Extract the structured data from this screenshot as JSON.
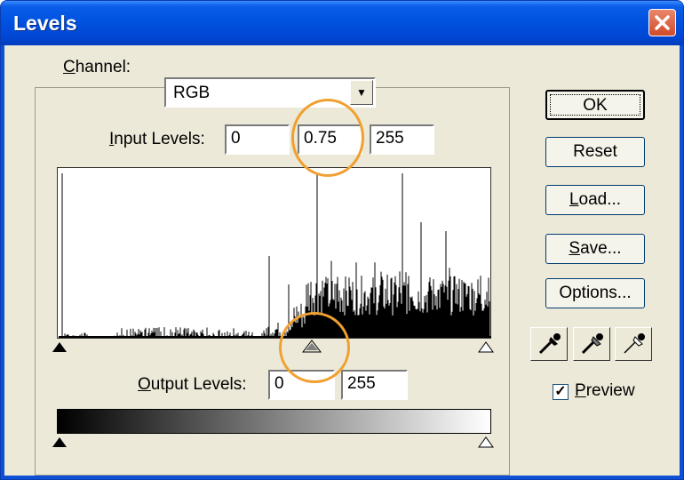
{
  "window": {
    "title": "Levels"
  },
  "channel": {
    "label": "Channel:",
    "value": "RGB"
  },
  "input_levels": {
    "label": "Input Levels:",
    "black": "0",
    "gamma": "0.75",
    "white": "255"
  },
  "output_levels": {
    "label": "Output Levels:",
    "black": "0",
    "white": "255"
  },
  "buttons": {
    "ok": "OK",
    "reset": "Reset",
    "load": "Load...",
    "save": "Save...",
    "options": "Options..."
  },
  "preview": {
    "label": "Preview",
    "checked": true
  },
  "colors": {
    "title_bar": "#0052e0",
    "dialog_bg": "#ece9d8",
    "highlight_circle": "#f0a030"
  },
  "eyedroppers": [
    "black-eyedropper-icon",
    "gray-eyedropper-icon",
    "white-eyedropper-icon"
  ]
}
